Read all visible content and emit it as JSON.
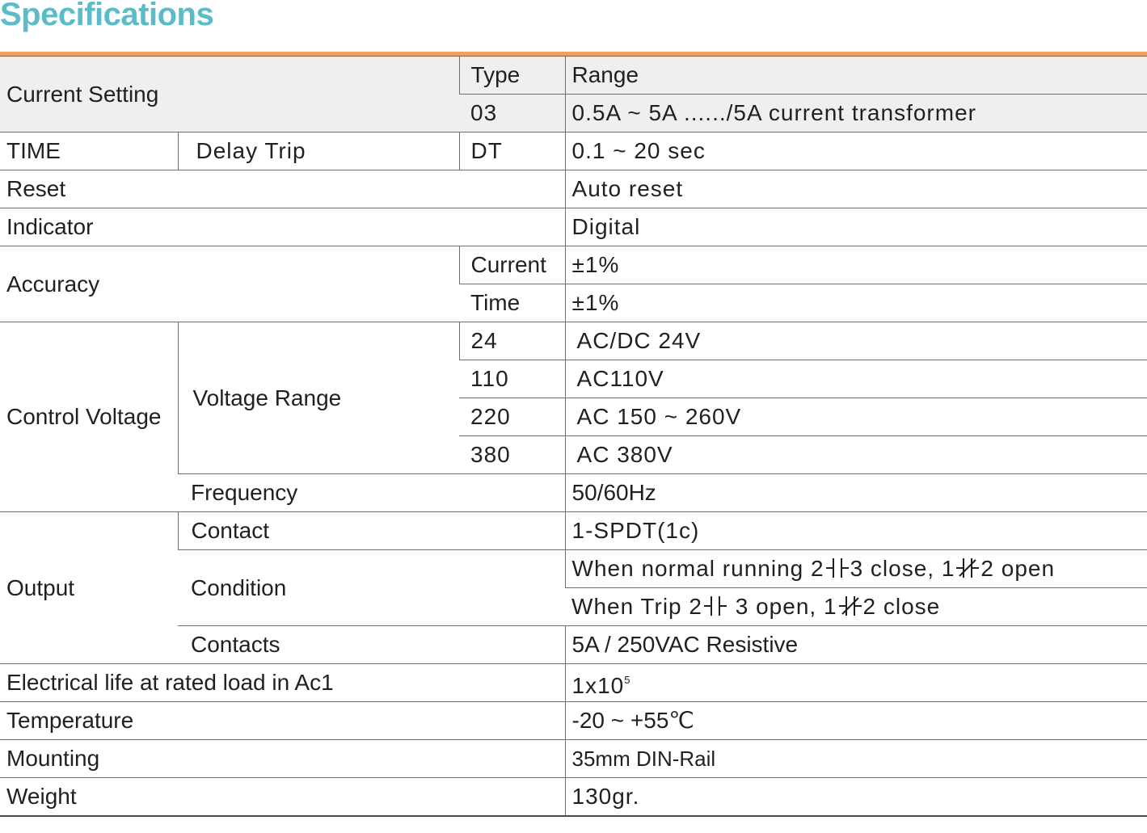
{
  "title": "Specifications",
  "table": {
    "header": {
      "label": "Current Setting",
      "type_label": "Type",
      "range_label": "Range"
    },
    "current_setting": {
      "type": "03",
      "range": "0.5A ~ 5A ....../5A current transformer"
    },
    "time": {
      "label": "TIME",
      "sub": "Delay Trip",
      "type": "DT",
      "value": "0.1 ~ 20 sec"
    },
    "reset": {
      "label": "Reset",
      "value": "Auto reset"
    },
    "indicator": {
      "label": "Indicator",
      "value": "Digital"
    },
    "accuracy": {
      "label": "Accuracy",
      "rows": [
        {
          "type": "Current",
          "value": "±1%"
        },
        {
          "type": "Time",
          "value": "±1%"
        }
      ]
    },
    "control_voltage": {
      "label": "Control Voltage",
      "voltage_range_label": "Voltage Range",
      "rows": [
        {
          "type": "24",
          "value": "AC/DC 24V"
        },
        {
          "type": "110",
          "value": "AC110V"
        },
        {
          "type": "220",
          "value": "AC 150 ~ 260V"
        },
        {
          "type": "380",
          "value": "AC 380V"
        }
      ],
      "frequency_label": "Frequency",
      "frequency_value": "50/60Hz"
    },
    "output": {
      "label": "Output",
      "contact_label": "Contact",
      "contact_value": "1-SPDT(1c)",
      "condition_label": "Condition",
      "condition_normal": {
        "prefix": "When normal running  2",
        "mid": "3 close, 1",
        "suffix": "2 open"
      },
      "condition_trip": {
        "prefix": "When Trip 2",
        "mid": " 3 open, 1",
        "suffix": "2 close"
      },
      "contacts_label": "Contacts",
      "contacts_value": "5A / 250VAC Resistive"
    },
    "electrical_life": {
      "label": "Electrical life at rated load in Ac1",
      "value": "1x10",
      "exponent": "5"
    },
    "temperature": {
      "label": "Temperature",
      "value": "-20 ~ +55℃"
    },
    "mounting": {
      "label": "Mounting",
      "value": "35mm DIN-Rail"
    },
    "weight": {
      "label": "Weight",
      "value": "130gr."
    }
  }
}
